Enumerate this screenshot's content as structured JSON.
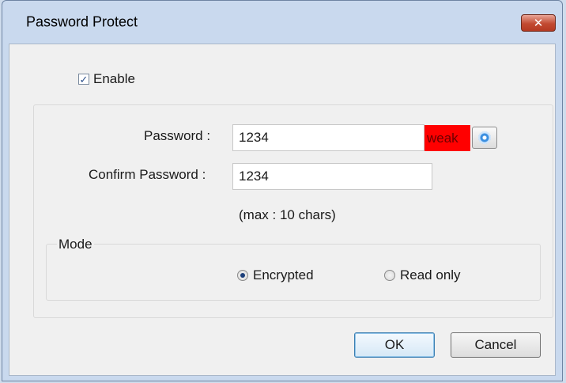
{
  "window": {
    "title": "Password Protect",
    "close_glyph": "✕"
  },
  "enable": {
    "label": "Enable",
    "checked": true
  },
  "password": {
    "label": "Password :",
    "value": "1234",
    "strength": "weak",
    "strength_color": "#ff0000"
  },
  "confirm": {
    "label": "Confirm Password :",
    "value": "1234"
  },
  "hint": "(max : 10 chars)",
  "mode": {
    "legend": "Mode",
    "options": [
      {
        "label": "Encrypted",
        "selected": true
      },
      {
        "label": "Read only",
        "selected": false
      }
    ]
  },
  "buttons": {
    "ok": "OK",
    "cancel": "Cancel"
  },
  "icons": {
    "reveal": "eye-icon",
    "check": "checkmark-icon"
  }
}
